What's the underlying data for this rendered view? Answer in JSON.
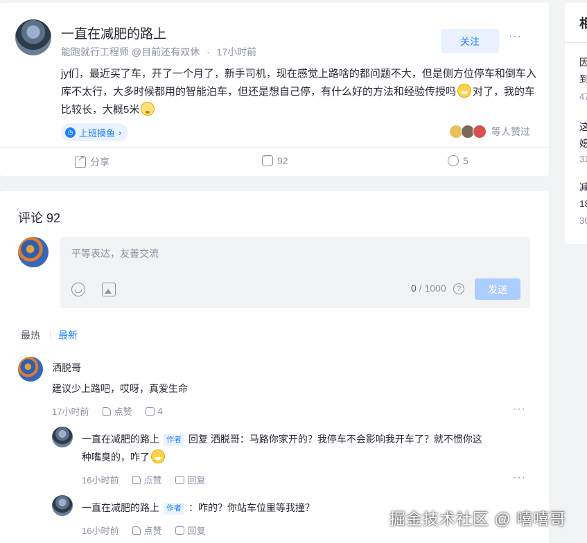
{
  "post": {
    "title": "一直在减肥的路上",
    "author_meta": "能跑就行工程师 @目前还有双休",
    "dot": "·",
    "time": "17小时前",
    "follow_label": "关注",
    "more": "···",
    "content_part1": "jy们，最近买了车，开了一个月了，新手司机，现在感觉上路啥的都问题不大，但是侧方位停车和倒车入库不太行，大多时候都用的智能泊车，但还是想自己停，有什么好的方法和经验传授吗",
    "content_part2": "对了，我的车比较长，大概5米",
    "topic_tag": "上班摸鱼",
    "topic_tag_arrow": "›",
    "likers_text": "等人赞过",
    "actions": {
      "share": "分享",
      "comments": "92",
      "collect": "5"
    },
    "icons": [
      "share-icon",
      "comment-icon",
      "collect-icon",
      "more-icon",
      "grin-emoji",
      "dizzy-emoji"
    ]
  },
  "comments_section": {
    "title": "评论 92",
    "editor_placeholder": "平等表达，友善交流",
    "counter_current": "0",
    "counter_max": " / 1000",
    "help": "?",
    "send_label": "发送",
    "sort_hot": "最热",
    "sort_new": "最新",
    "active_color": "#1e80ff",
    "comments": [
      {
        "name": "洒脱哥",
        "text": "建议少上路吧，哎呀，真爱生命",
        "time": "17小时前",
        "like_label": "点赞",
        "reply_count": "4",
        "more": "···"
      }
    ],
    "replies": [
      {
        "name": "一直在减肥的路上",
        "author_tag": "作者",
        "reply_prefix": "回复 洒脱哥：",
        "text_line1": "马路你家开的？我停车不会影响我开车了？就不惯你这",
        "text_line2": "种嘴臭的，咋了",
        "time": "16小时前",
        "like_label": "点赞",
        "reply_label": "回复",
        "more": "···"
      },
      {
        "name": "一直在减肥的路上",
        "author_tag": "作者",
        "text_line1": "：咋的？你站车位里等我撞？",
        "time": "16小时前",
        "like_label": "点赞",
        "reply_label": "回复"
      }
    ]
  },
  "related": {
    "title": "相",
    "items": [
      {
        "line1": "因",
        "line2": "到",
        "sub": "47"
      },
      {
        "line1": "这",
        "line2": "媳",
        "sub": "31"
      },
      {
        "line1": "减",
        "line2": "18",
        "sub": "36"
      }
    ]
  },
  "watermark": "掘金技术社区 @ 嘻嘻哥"
}
